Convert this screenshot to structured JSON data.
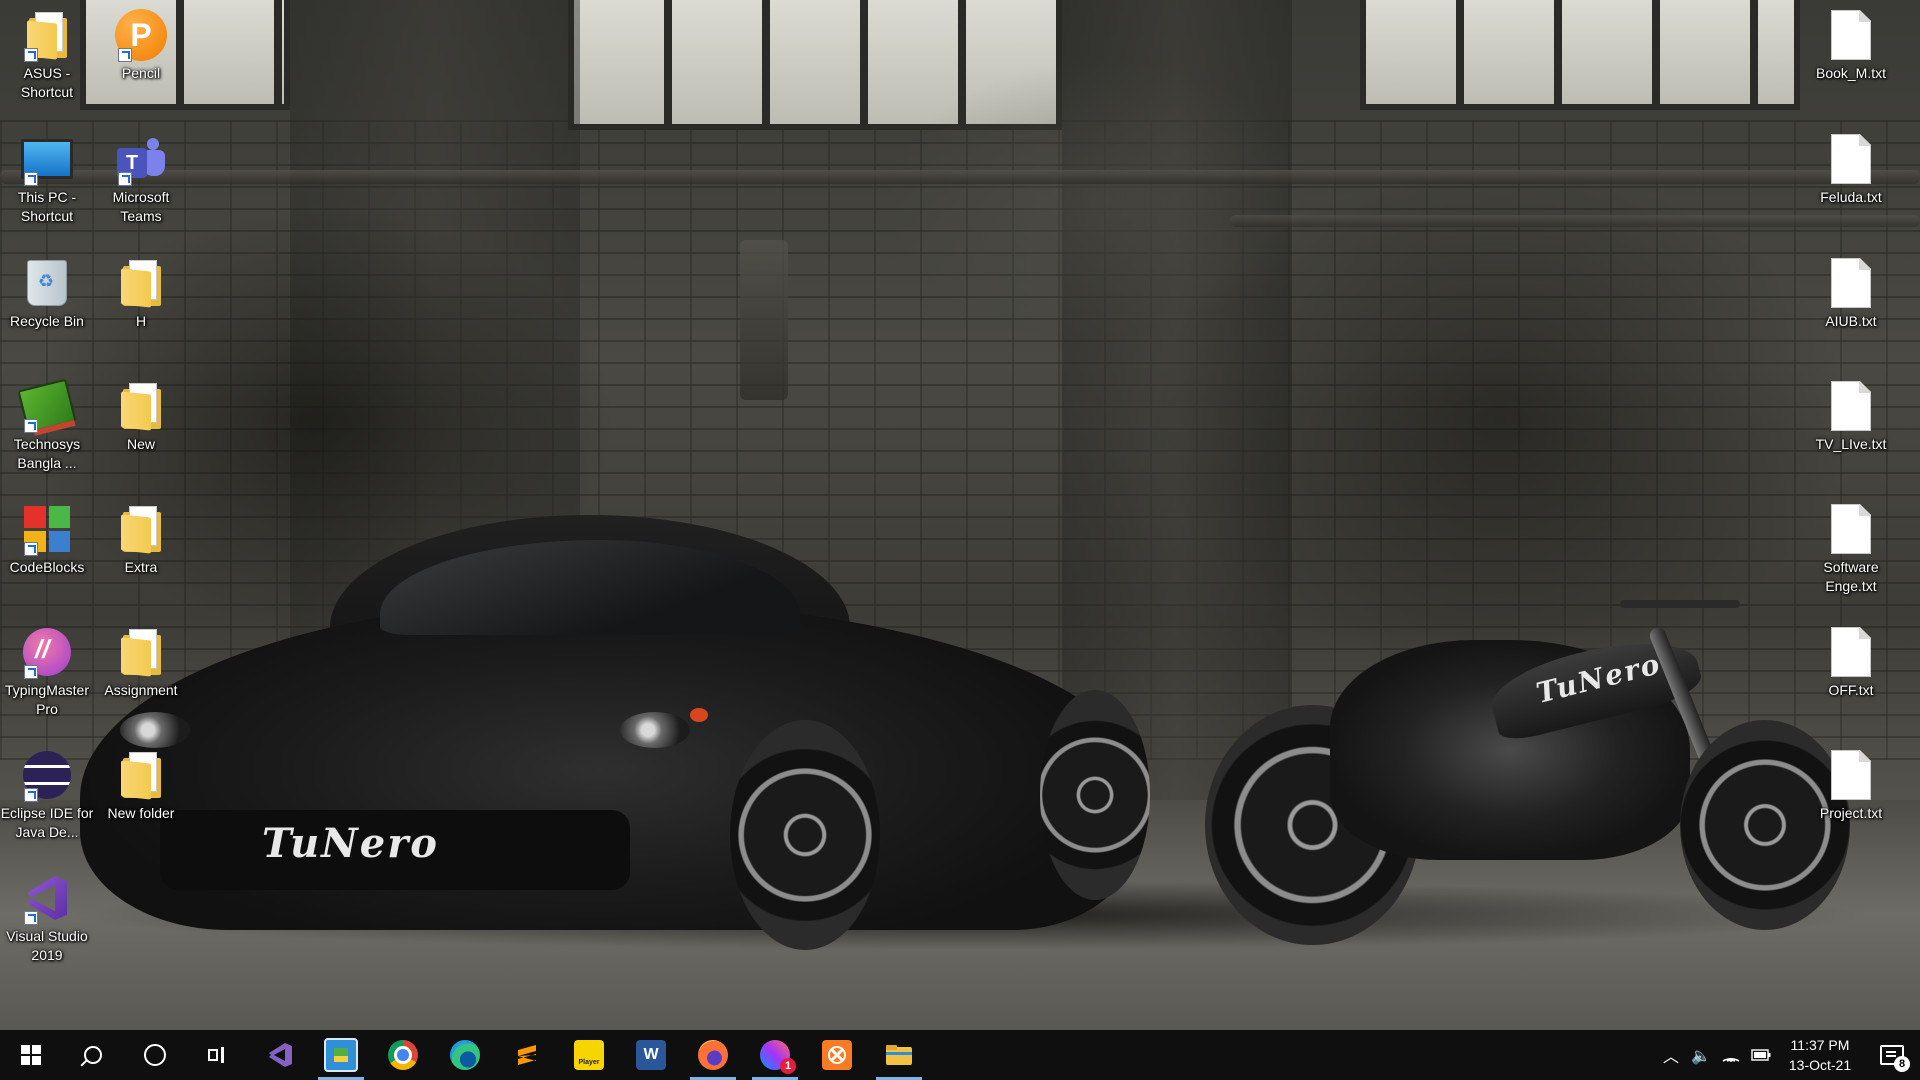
{
  "desktop": {
    "left_column_1": [
      {
        "label": "ASUS - Shortcut",
        "icon": "folder-shortcut-icon"
      },
      {
        "label": "This PC - Shortcut",
        "icon": "computer-icon"
      },
      {
        "label": "Recycle Bin",
        "icon": "recycle-bin-icon"
      },
      {
        "label": "Technosys Bangla ...",
        "icon": "book-icon"
      },
      {
        "label": "CodeBlocks",
        "icon": "codeblocks-icon"
      },
      {
        "label": "TypingMaster Pro",
        "icon": "typingmaster-icon"
      },
      {
        "label": "Eclipse IDE for Java De...",
        "icon": "eclipse-icon"
      },
      {
        "label": "Visual Studio 2019",
        "icon": "visual-studio-icon"
      }
    ],
    "left_column_2": [
      {
        "label": "Pencil",
        "icon": "pencil-app-icon"
      },
      {
        "label": "Microsoft Teams",
        "icon": "teams-icon"
      },
      {
        "label": "H",
        "icon": "folder-icon"
      },
      {
        "label": "New",
        "icon": "folder-icon"
      },
      {
        "label": "Extra",
        "icon": "folder-icon"
      },
      {
        "label": "Assignment",
        "icon": "folder-icon"
      },
      {
        "label": "New folder",
        "icon": "folder-icon"
      }
    ],
    "right_column": [
      {
        "label": "Book_M.txt",
        "icon": "text-file-icon"
      },
      {
        "label": "Feluda.txt",
        "icon": "text-file-icon"
      },
      {
        "label": "AIUB.txt",
        "icon": "text-file-icon"
      },
      {
        "label": "TV_LIve.txt",
        "icon": "text-file-icon"
      },
      {
        "label": "Software Enge.txt",
        "icon": "text-file-icon"
      },
      {
        "label": "OFF.txt",
        "icon": "text-file-icon"
      },
      {
        "label": "Project.txt",
        "icon": "text-file-icon"
      }
    ],
    "wallpaper_text": {
      "car": "TuNero",
      "bike": "TuNero"
    }
  },
  "taskbar": {
    "apps": [
      {
        "name": "visual-studio-taskbar-icon",
        "active": false
      },
      {
        "name": "pc-app-taskbar-icon",
        "active": true
      },
      {
        "name": "chrome-taskbar-icon",
        "active": false
      },
      {
        "name": "edge-taskbar-icon",
        "active": false
      },
      {
        "name": "sublime-taskbar-icon",
        "active": false
      },
      {
        "name": "player-taskbar-icon",
        "active": false
      },
      {
        "name": "word-taskbar-icon",
        "active": false
      },
      {
        "name": "firefox-taskbar-icon",
        "active": true
      },
      {
        "name": "messenger-taskbar-icon",
        "active": true
      },
      {
        "name": "xampp-taskbar-icon",
        "active": false
      },
      {
        "name": "file-explorer-taskbar-icon",
        "active": true
      }
    ],
    "messenger_badge": "1",
    "player_label": "Player",
    "word_label": "W",
    "clock": {
      "time": "11:37 PM",
      "date": "13-Oct-21"
    },
    "notification_count": "8"
  },
  "colors": {
    "taskbar": "#0f0f10",
    "active_indicator": "#7fb4e6",
    "folder": "#f3c94f"
  }
}
